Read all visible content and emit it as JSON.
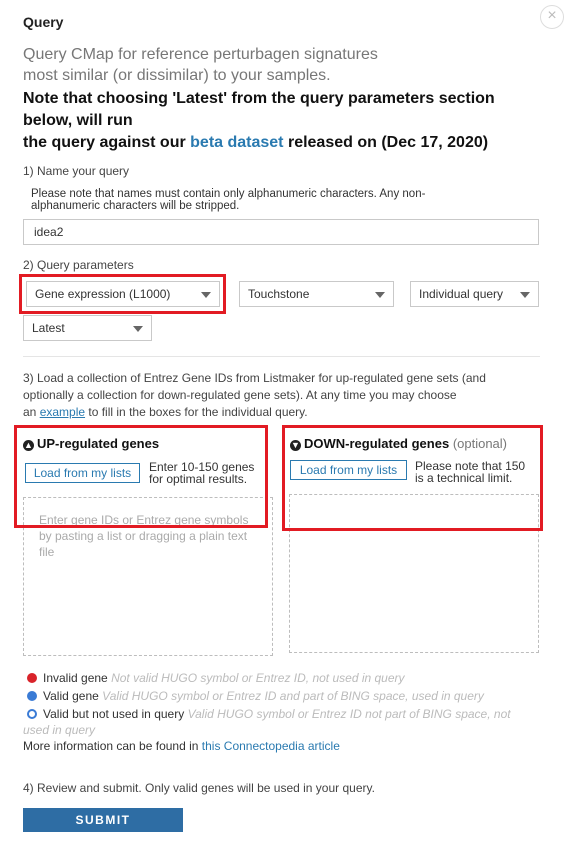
{
  "header": {
    "title": "Query",
    "close_glyph": "×"
  },
  "intro": {
    "line1": "Query CMap for reference perturbagen signatures",
    "line2": "most similar (or dissimilar) to your samples."
  },
  "note": {
    "line1": "Note that choosing 'Latest' from the query parameters section",
    "line2": "below, will run",
    "line3_pre": "the query against our ",
    "link": "beta dataset",
    "line3_post": " released on (Dec 17, 2020)"
  },
  "step1": {
    "label": "1) Name your query",
    "hint1": "Please note that names must contain only alphanumeric characters. Any non-",
    "hint2": "alphanumeric characters will be stripped.",
    "value": "idea2"
  },
  "step2": {
    "label": "2) Query parameters",
    "selects": [
      "Gene expression (L1000)",
      "Touchstone",
      "Individual query",
      "Latest"
    ]
  },
  "step3": {
    "line1": "3) Load a collection of Entrez Gene IDs from Listmaker for up-regulated gene sets (and",
    "line2": "optionally a collection for down-regulated gene sets). At any time you may choose",
    "line3_pre": "an ",
    "example": "example",
    "line3_post": " to fill in the boxes for the individual query."
  },
  "up": {
    "title": "UP-regulated genes",
    "load": "Load from my lists",
    "hint1": "Enter 10-150 genes",
    "hint2": "for optimal results.",
    "ph1": "Enter gene IDs or Entrez gene symbols",
    "ph2": "by pasting a list or dragging a plain text",
    "ph3": "file"
  },
  "down": {
    "title": "DOWN-regulated genes",
    "optional": "(optional)",
    "load": "Load from my lists",
    "hint1": "Please note that 150",
    "hint2": "is a technical limit."
  },
  "legend": {
    "invalid": "Invalid gene",
    "invalid_desc": "Not valid HUGO symbol or Entrez ID, not used in query",
    "valid": "Valid gene",
    "valid_desc": "Valid HUGO symbol or Entrez ID and part of BING space, used in query",
    "unused": "Valid but not used in query",
    "unused_desc1": "Valid HUGO symbol or Entrez ID not part of BING space, not",
    "unused_desc2": "used in query",
    "more_pre": "More information can be found in ",
    "more_link": "this Connectopedia article"
  },
  "step4": {
    "label": "4) Review and submit. Only valid genes will be used in your query.",
    "submit": "SUBMIT"
  },
  "colors": {
    "accent": "#2a7ab0",
    "highlight": "#e21b23",
    "submit_bg": "#2e6da4"
  }
}
